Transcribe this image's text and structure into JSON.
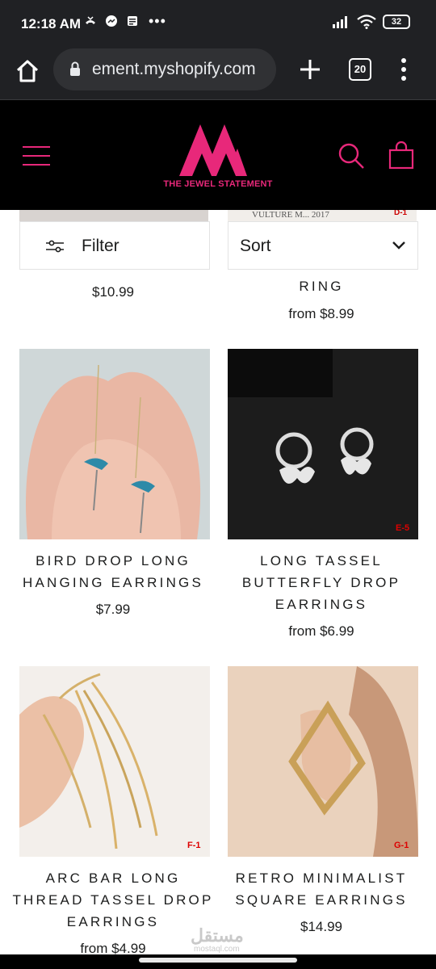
{
  "status_bar": {
    "time": "12:18 AM",
    "more": "•••",
    "battery": "32"
  },
  "browser": {
    "url": "ement.myshopify.com",
    "tab_count": "20"
  },
  "store": {
    "name": "THE JEWEL STATEMENT",
    "brand_color": "#e8287a"
  },
  "toolbar": {
    "filter_label": "Filter",
    "sort_label": "Sort"
  },
  "top_strip": {
    "right_text": "VULTURE M... 2017",
    "right_tag": "D-1"
  },
  "partial_row": {
    "left_price": "$10.99",
    "right_title": "RING",
    "right_price": "from $8.99"
  },
  "products": [
    {
      "title": "BIRD DROP LONG HANGING EARRINGS",
      "price": "$7.99",
      "tag": ""
    },
    {
      "title": "LONG TASSEL BUTTERFLY DROP EARRINGS",
      "price": "from $6.99",
      "tag": "E-5"
    },
    {
      "title": "ARC BAR LONG THREAD TASSEL DROP EARRINGS",
      "price": "from $4.99",
      "tag": "F-1"
    },
    {
      "title": "RETRO MINIMALIST SQUARE EARRINGS",
      "price": "$14.99",
      "tag": "G-1"
    }
  ],
  "watermark": {
    "text": "مستقل",
    "sub": "mostaql.com"
  },
  "icons": [
    "home-icon",
    "lock-icon",
    "plus-icon",
    "tabs-icon",
    "more-vert-icon",
    "hamburger-icon",
    "search-icon",
    "cart-icon",
    "filter-icon",
    "chevron-down-icon"
  ]
}
